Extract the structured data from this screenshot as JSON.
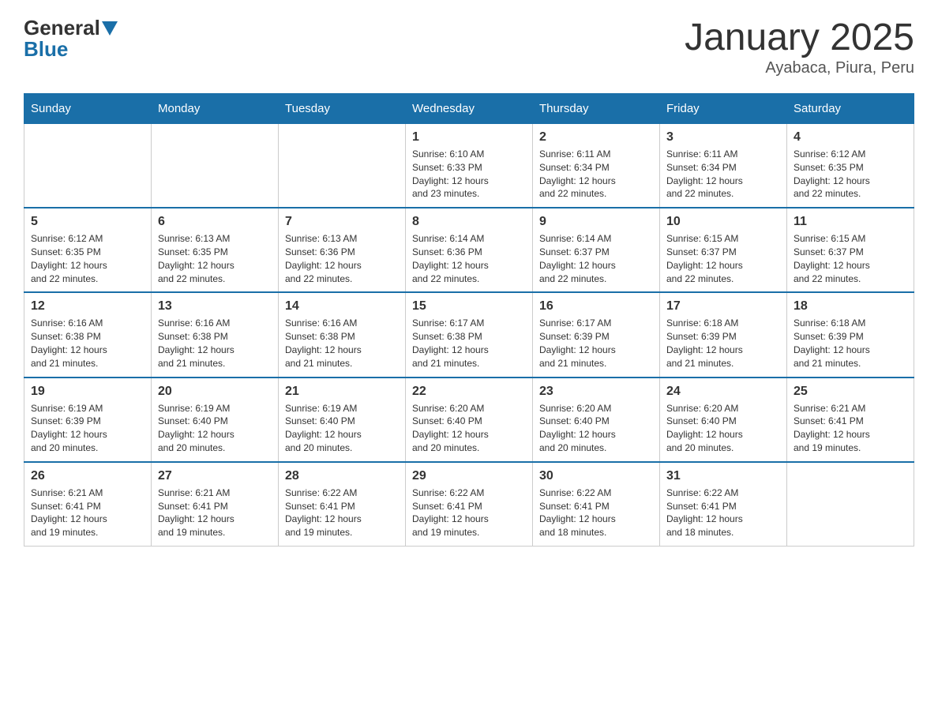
{
  "header": {
    "logo_general": "General",
    "logo_blue": "Blue",
    "month_title": "January 2025",
    "location": "Ayabaca, Piura, Peru"
  },
  "calendar": {
    "days_of_week": [
      "Sunday",
      "Monday",
      "Tuesday",
      "Wednesday",
      "Thursday",
      "Friday",
      "Saturday"
    ],
    "weeks": [
      [
        {
          "day": "",
          "info": ""
        },
        {
          "day": "",
          "info": ""
        },
        {
          "day": "",
          "info": ""
        },
        {
          "day": "1",
          "info": "Sunrise: 6:10 AM\nSunset: 6:33 PM\nDaylight: 12 hours\nand 23 minutes."
        },
        {
          "day": "2",
          "info": "Sunrise: 6:11 AM\nSunset: 6:34 PM\nDaylight: 12 hours\nand 22 minutes."
        },
        {
          "day": "3",
          "info": "Sunrise: 6:11 AM\nSunset: 6:34 PM\nDaylight: 12 hours\nand 22 minutes."
        },
        {
          "day": "4",
          "info": "Sunrise: 6:12 AM\nSunset: 6:35 PM\nDaylight: 12 hours\nand 22 minutes."
        }
      ],
      [
        {
          "day": "5",
          "info": "Sunrise: 6:12 AM\nSunset: 6:35 PM\nDaylight: 12 hours\nand 22 minutes."
        },
        {
          "day": "6",
          "info": "Sunrise: 6:13 AM\nSunset: 6:35 PM\nDaylight: 12 hours\nand 22 minutes."
        },
        {
          "day": "7",
          "info": "Sunrise: 6:13 AM\nSunset: 6:36 PM\nDaylight: 12 hours\nand 22 minutes."
        },
        {
          "day": "8",
          "info": "Sunrise: 6:14 AM\nSunset: 6:36 PM\nDaylight: 12 hours\nand 22 minutes."
        },
        {
          "day": "9",
          "info": "Sunrise: 6:14 AM\nSunset: 6:37 PM\nDaylight: 12 hours\nand 22 minutes."
        },
        {
          "day": "10",
          "info": "Sunrise: 6:15 AM\nSunset: 6:37 PM\nDaylight: 12 hours\nand 22 minutes."
        },
        {
          "day": "11",
          "info": "Sunrise: 6:15 AM\nSunset: 6:37 PM\nDaylight: 12 hours\nand 22 minutes."
        }
      ],
      [
        {
          "day": "12",
          "info": "Sunrise: 6:16 AM\nSunset: 6:38 PM\nDaylight: 12 hours\nand 21 minutes."
        },
        {
          "day": "13",
          "info": "Sunrise: 6:16 AM\nSunset: 6:38 PM\nDaylight: 12 hours\nand 21 minutes."
        },
        {
          "day": "14",
          "info": "Sunrise: 6:16 AM\nSunset: 6:38 PM\nDaylight: 12 hours\nand 21 minutes."
        },
        {
          "day": "15",
          "info": "Sunrise: 6:17 AM\nSunset: 6:38 PM\nDaylight: 12 hours\nand 21 minutes."
        },
        {
          "day": "16",
          "info": "Sunrise: 6:17 AM\nSunset: 6:39 PM\nDaylight: 12 hours\nand 21 minutes."
        },
        {
          "day": "17",
          "info": "Sunrise: 6:18 AM\nSunset: 6:39 PM\nDaylight: 12 hours\nand 21 minutes."
        },
        {
          "day": "18",
          "info": "Sunrise: 6:18 AM\nSunset: 6:39 PM\nDaylight: 12 hours\nand 21 minutes."
        }
      ],
      [
        {
          "day": "19",
          "info": "Sunrise: 6:19 AM\nSunset: 6:39 PM\nDaylight: 12 hours\nand 20 minutes."
        },
        {
          "day": "20",
          "info": "Sunrise: 6:19 AM\nSunset: 6:40 PM\nDaylight: 12 hours\nand 20 minutes."
        },
        {
          "day": "21",
          "info": "Sunrise: 6:19 AM\nSunset: 6:40 PM\nDaylight: 12 hours\nand 20 minutes."
        },
        {
          "day": "22",
          "info": "Sunrise: 6:20 AM\nSunset: 6:40 PM\nDaylight: 12 hours\nand 20 minutes."
        },
        {
          "day": "23",
          "info": "Sunrise: 6:20 AM\nSunset: 6:40 PM\nDaylight: 12 hours\nand 20 minutes."
        },
        {
          "day": "24",
          "info": "Sunrise: 6:20 AM\nSunset: 6:40 PM\nDaylight: 12 hours\nand 20 minutes."
        },
        {
          "day": "25",
          "info": "Sunrise: 6:21 AM\nSunset: 6:41 PM\nDaylight: 12 hours\nand 19 minutes."
        }
      ],
      [
        {
          "day": "26",
          "info": "Sunrise: 6:21 AM\nSunset: 6:41 PM\nDaylight: 12 hours\nand 19 minutes."
        },
        {
          "day": "27",
          "info": "Sunrise: 6:21 AM\nSunset: 6:41 PM\nDaylight: 12 hours\nand 19 minutes."
        },
        {
          "day": "28",
          "info": "Sunrise: 6:22 AM\nSunset: 6:41 PM\nDaylight: 12 hours\nand 19 minutes."
        },
        {
          "day": "29",
          "info": "Sunrise: 6:22 AM\nSunset: 6:41 PM\nDaylight: 12 hours\nand 19 minutes."
        },
        {
          "day": "30",
          "info": "Sunrise: 6:22 AM\nSunset: 6:41 PM\nDaylight: 12 hours\nand 18 minutes."
        },
        {
          "day": "31",
          "info": "Sunrise: 6:22 AM\nSunset: 6:41 PM\nDaylight: 12 hours\nand 18 minutes."
        },
        {
          "day": "",
          "info": ""
        }
      ]
    ]
  }
}
